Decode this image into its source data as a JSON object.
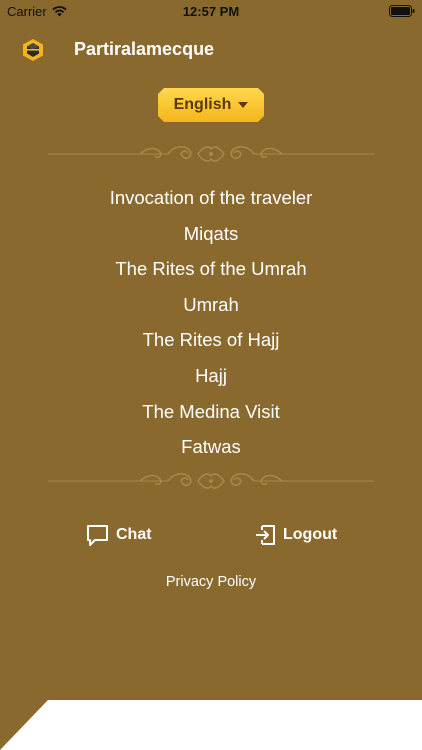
{
  "status_bar": {
    "carrier": "Carrier",
    "time": "12:57 PM"
  },
  "nav": {
    "title": "Partiralamecque",
    "logo_icon": "kaaba-icon"
  },
  "language": {
    "selected": "English"
  },
  "menu": [
    {
      "label": "Invocation of the traveler"
    },
    {
      "label": "Miqats"
    },
    {
      "label": "The Rites of the Umrah"
    },
    {
      "label": "Umrah"
    },
    {
      "label": "The Rites of Hajj"
    },
    {
      "label": "Hajj"
    },
    {
      "label": "The Medina Visit"
    },
    {
      "label": "Fatwas"
    }
  ],
  "actions": {
    "chat_label": "Chat",
    "chat_icon": "chat-bubble-icon",
    "logout_label": "Logout",
    "logout_icon": "logout-icon"
  },
  "footer": {
    "privacy_label": "Privacy Policy"
  },
  "colors": {
    "background": "#8a692f",
    "accent_gold": "#f4b61c",
    "ornament": "#a8884a"
  }
}
